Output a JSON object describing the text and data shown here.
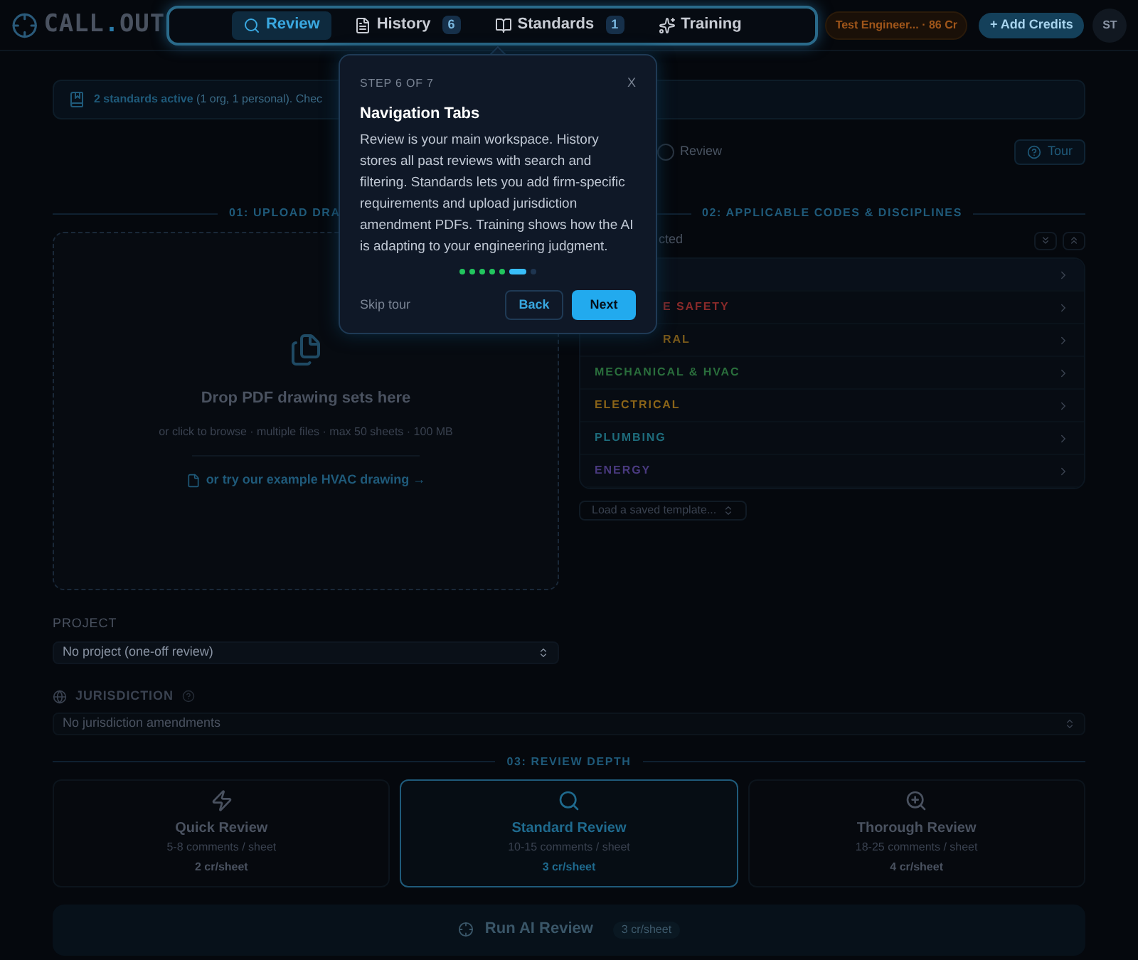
{
  "brand": {
    "part1": "CALL",
    "dot": ".",
    "part2": "OUT"
  },
  "nav": [
    {
      "label": "Review",
      "selected": true
    },
    {
      "label": "History",
      "badge": "6",
      "selected": false
    },
    {
      "label": "Standards",
      "badge": "1",
      "selected": false
    },
    {
      "label": "Training",
      "selected": false
    }
  ],
  "account": {
    "credits": "Test Engineer... · 86 Cr",
    "add_credits": "+ Add Credits",
    "avatar": "ST"
  },
  "banner": {
    "bold": "2 standards active",
    "text": " (1 org, 1 personal). Chec"
  },
  "stepper_label": "Review",
  "tour_button": "Tour",
  "upload": {
    "heading": "01: UPLOAD DRA",
    "title": "Drop PDF drawing sets here",
    "hint": "or click to browse · multiple files · max 50 sheets · 100 MB",
    "example_link": "or try our example HVAC drawing →"
  },
  "codes": {
    "heading": "02: APPLICABLE CODES & DISCIPLINES",
    "selected_count": "cted",
    "disciplines": [
      {
        "kind": "covered"
      },
      {
        "label": "E SAFETY",
        "color": "#8a2a2a",
        "cut": true
      },
      {
        "label": "RAL",
        "color": "#7a5a1a",
        "cut": true
      },
      {
        "label": "MECHANICAL & HVAC",
        "color": "#2a6e3c",
        "cut": false
      },
      {
        "label": "ELECTRICAL",
        "color": "#8a6418",
        "cut": false
      },
      {
        "label": "PLUMBING",
        "color": "#1e6c7c",
        "cut": false
      },
      {
        "label": "ENERGY",
        "color": "#4a3a80",
        "cut": false
      }
    ],
    "template": "Load a saved template..."
  },
  "project": {
    "label": "PROJECT",
    "value": "No project (one-off review)"
  },
  "jurisdiction": {
    "label": "JURISDICTION",
    "placeholder": "No jurisdiction amendments"
  },
  "depth": {
    "heading": "03: REVIEW DEPTH",
    "options": [
      {
        "title": "Quick Review",
        "detail": "5-8 comments / sheet",
        "cost": "2 cr/sheet",
        "selected": false
      },
      {
        "title": "Standard Review",
        "detail": "10-15 comments / sheet",
        "cost": "3 cr/sheet",
        "selected": true
      },
      {
        "title": "Thorough Review",
        "detail": "18-25 comments / sheet",
        "cost": "4 cr/sheet",
        "selected": false
      }
    ]
  },
  "run": {
    "label": "Run AI Review",
    "cost": "3 cr/sheet",
    "disabled": true
  },
  "tour": {
    "step": "STEP 6 OF 7",
    "close": "X",
    "title": "Navigation Tabs",
    "body": "Review is your main workspace. History stores all past reviews with search and filtering. Standards lets you add firm-specific requirements and upload jurisdiction amendment PDFs. Training shows how the AI is adapting to your engineering judgment.",
    "dots": [
      {
        "kind": "done"
      },
      {
        "kind": "done"
      },
      {
        "kind": "done"
      },
      {
        "kind": "done"
      },
      {
        "kind": "done"
      },
      {
        "kind": "current"
      },
      {
        "kind": "todo"
      }
    ],
    "skip": "Skip tour",
    "back": "Back",
    "next": "Next"
  }
}
